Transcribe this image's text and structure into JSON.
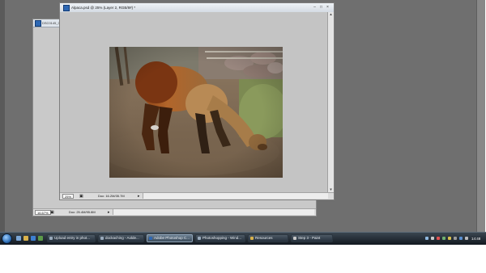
{
  "back_window": {
    "title": "DSC0145_0266",
    "zoom": "16.67%",
    "doc_info": "Doc: 25.4M/95.8M"
  },
  "front_window": {
    "title": "Alpaca.psd @ 25% (Layer 2, RGB/8#) *",
    "zoom": "25%",
    "doc_info": "Doc: 16.2M/35.7M",
    "buttons": {
      "minimize": "–",
      "maximize": "□",
      "close": "×"
    }
  },
  "taskbar": {
    "items": [
      {
        "label": "Upload entry in phot..."
      },
      {
        "label": "dockaching - Aolde..."
      },
      {
        "label": "Adobe Photoshop C..."
      },
      {
        "label": "Photoshopping - Wind..."
      },
      {
        "label": "Resources"
      },
      {
        "label": "Step 3 - Paint"
      }
    ],
    "clock": "14:48"
  }
}
